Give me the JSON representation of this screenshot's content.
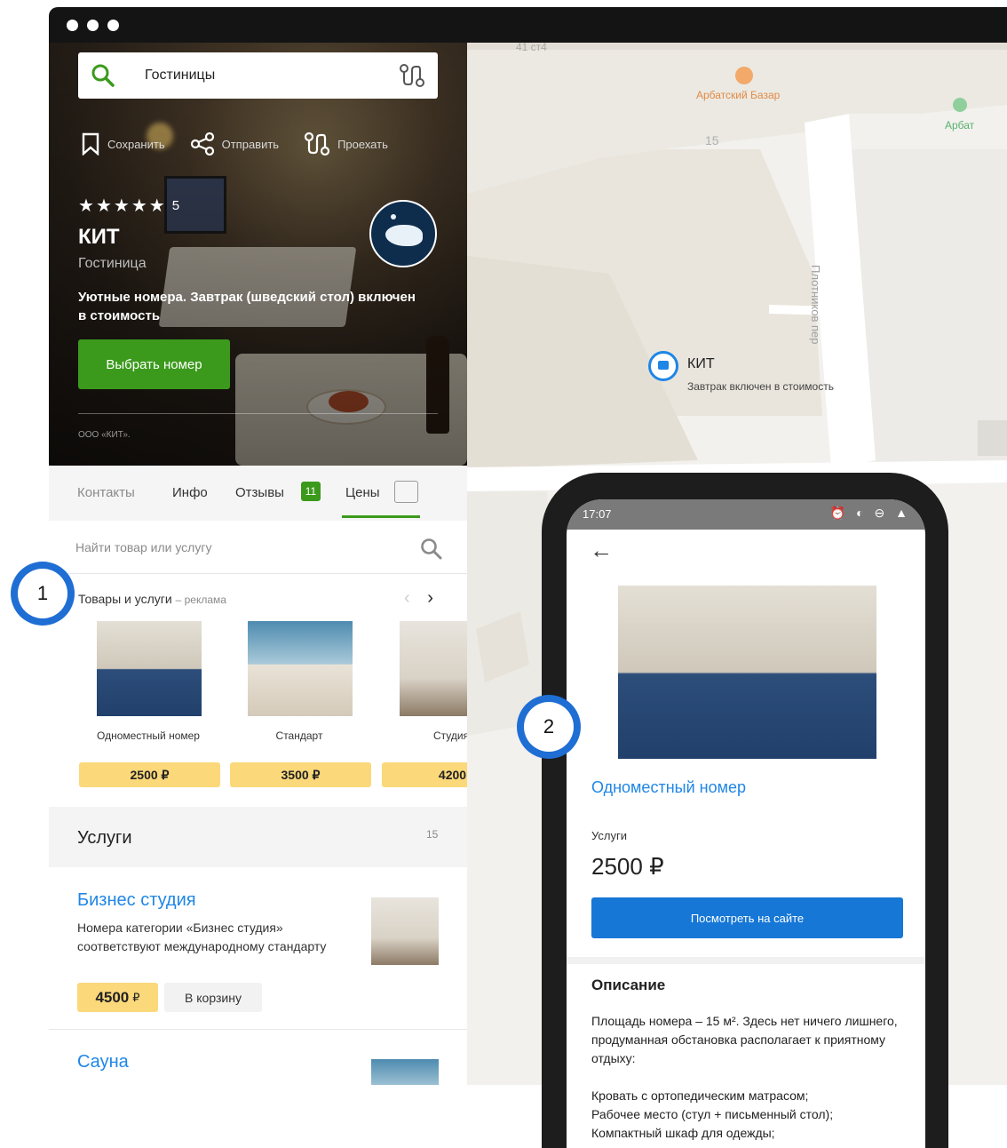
{
  "search": {
    "query": "Гостиницы"
  },
  "actions": {
    "save": "Сохранить",
    "share": "Отправить",
    "route": "Проехать"
  },
  "org": {
    "rating_count": "5",
    "name": "КИТ",
    "type": "Гостиница",
    "promo": "Уютные номера. Завтрак (шведский стол) включен в стоимость",
    "cta": "Выбрать номер",
    "legal": "ООО «КИТ»."
  },
  "tabs": {
    "contacts": "Контакты",
    "info": "Инфо",
    "reviews": "Отзывы",
    "reviews_count": "11",
    "prices": "Цены"
  },
  "find": {
    "placeholder": "Найти товар или услугу"
  },
  "goods": {
    "title": "Товары и услуги",
    "ad": "– реклама",
    "items": [
      {
        "name": "Одноместный номер",
        "price": "2500 ₽"
      },
      {
        "name": "Стандарт",
        "price": "3500 ₽"
      },
      {
        "name": "Студия",
        "price": "4200"
      }
    ]
  },
  "services": {
    "title": "Услуги",
    "count": "15",
    "items": [
      {
        "title": "Бизнес студия",
        "desc": "Номера категории «Бизнес студия» соответствуют международному стандарту",
        "price": "4500",
        "currency": "₽",
        "cart": "В корзину"
      },
      {
        "title": "Сауна"
      }
    ]
  },
  "map": {
    "labels": {
      "bazaar": "Арбатский Базар",
      "arbat": "Арбат",
      "num15": "15",
      "street": "Плотников пер",
      "top": "41 ст4",
      "pin_title": "КИТ",
      "pin_sub": "Завтрак включен в стоимость"
    }
  },
  "callouts": {
    "one": "1",
    "two": "2"
  },
  "phone": {
    "time": "17:07",
    "status_icons": "⏰ ◐ ⊖ ▲",
    "title": "Одноместный номер",
    "label": "Услуги",
    "price": "2500 ₽",
    "button": "Посмотреть на сайте",
    "desc_title": "Описание",
    "desc": "Площадь номера – 15 м². Здесь нет ничего лишнего, продуманная обстановка располагает к приятному отдыху:",
    "list": [
      "Кровать с ортопедическим матрасом;",
      "Рабочее место (стул + письменный стол);",
      "Компактный шкаф для одежды;"
    ]
  },
  "colors": {
    "green": "#3b9a1c",
    "blue": "#1f86e6",
    "yellow": "#fbd87a"
  }
}
